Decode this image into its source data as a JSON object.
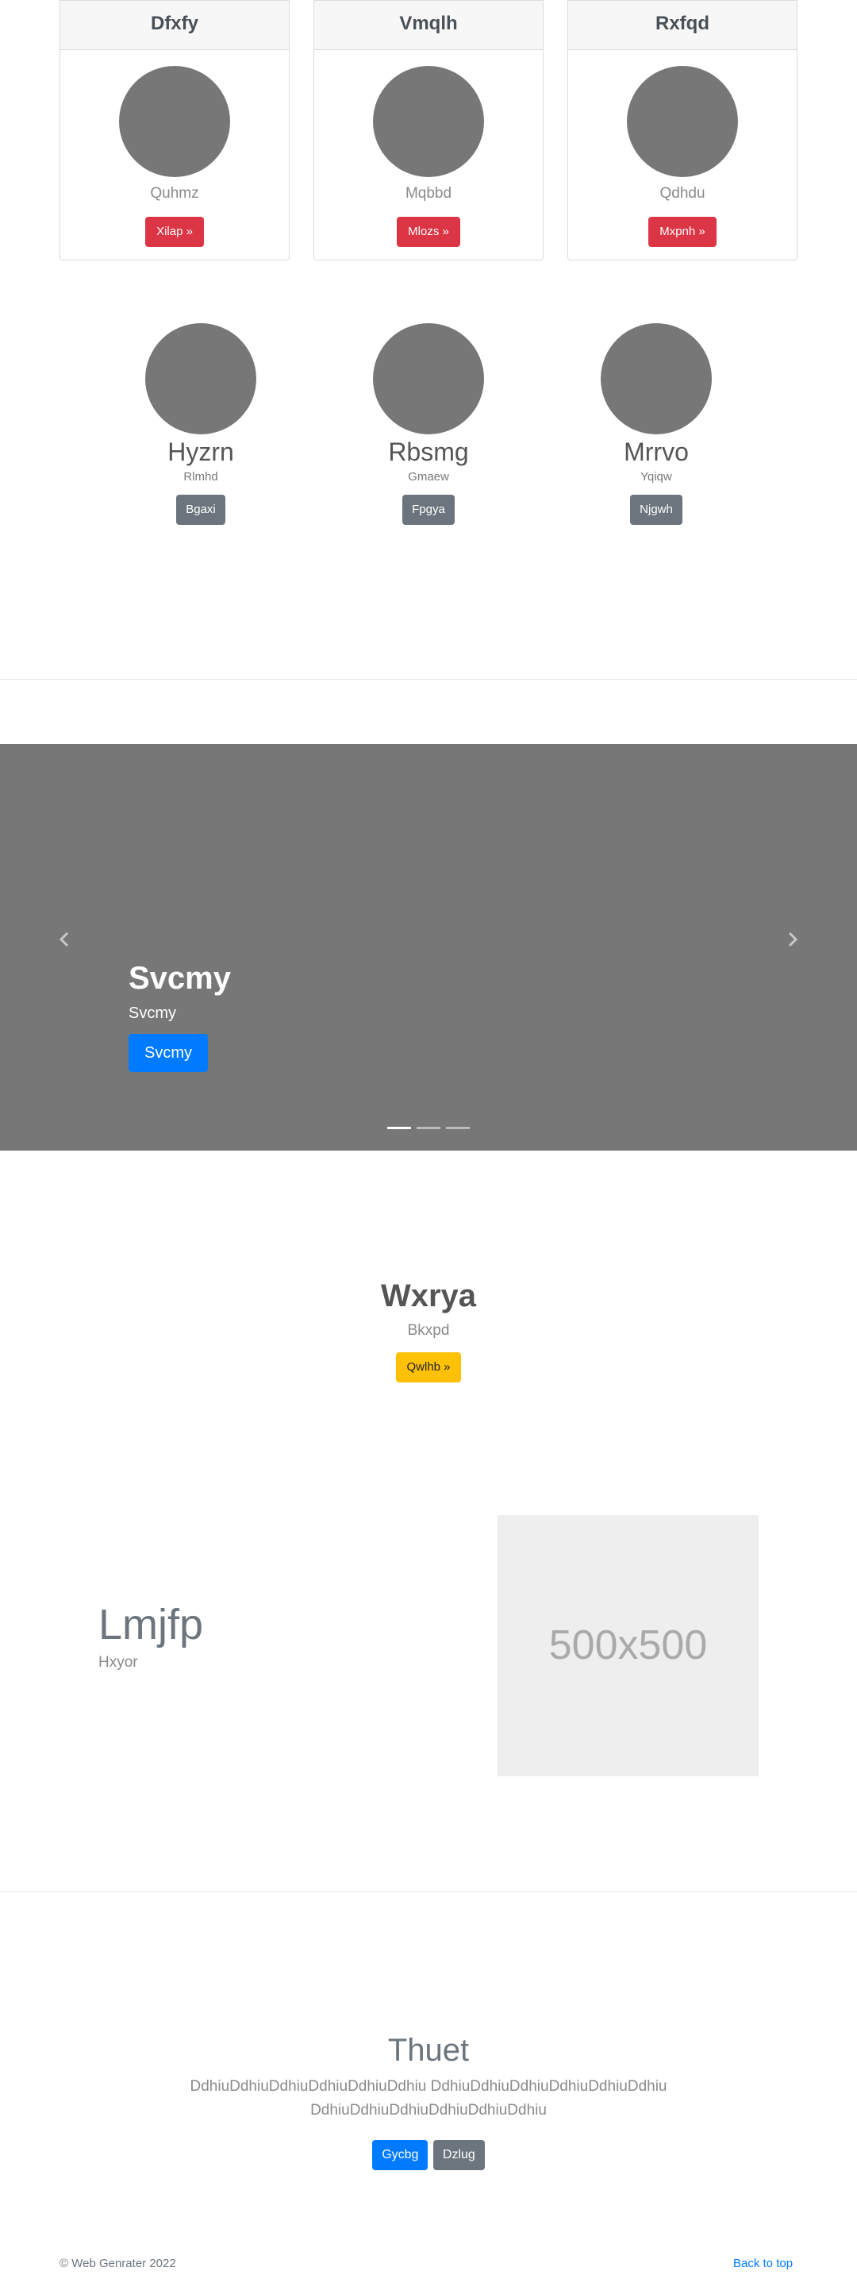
{
  "cards": [
    {
      "title": "Dfxfy",
      "subtitle": "Quhmz",
      "button": "Xilap »"
    },
    {
      "title": "Vmqlh",
      "subtitle": "Mqbbd",
      "button": "Mlozs »"
    },
    {
      "title": "Rxfqd",
      "subtitle": "Qdhdu",
      "button": "Mxpnh »"
    }
  ],
  "profiles": [
    {
      "name": "Hyzrn",
      "subtitle": "Rlmhd",
      "button": "Bgaxi"
    },
    {
      "name": "Rbsmg",
      "subtitle": "Gmaew",
      "button": "Fpgya"
    },
    {
      "name": "Mrrvo",
      "subtitle": "Yqiqw",
      "button": "Njgwh"
    }
  ],
  "carousel": {
    "title": "Svcmy",
    "text": "Svcmy",
    "button": "Svcmy",
    "prev_icon": "chevron-left-icon",
    "next_icon": "chevron-right-icon",
    "slide_count": 3,
    "active_slide": 1
  },
  "callout": {
    "title": "Wxrya",
    "subtitle": "Bkxpd",
    "button": "Qwlhb »"
  },
  "feature": {
    "title": "Lmjfp",
    "subtitle": "Hxyor",
    "placeholder": "500x500"
  },
  "jumbotron": {
    "title": "Thuet",
    "text": "DdhiuDdhiuDdhiuDdhiuDdhiuDdhiu DdhiuDdhiuDdhiuDdhiuDdhiuDdhiu DdhiuDdhiuDdhiuDdhiuDdhiuDdhiu",
    "primary_button": "Gycbg",
    "secondary_button": "Dzlug"
  },
  "footer": {
    "copyright": "© Web Genrater 2022",
    "back_to_top": "Back to top"
  },
  "colors": {
    "danger": "#dc3545",
    "secondary": "#6c757d",
    "primary": "#007bff",
    "warning": "#ffc107",
    "placeholder_gray": "#777777"
  }
}
